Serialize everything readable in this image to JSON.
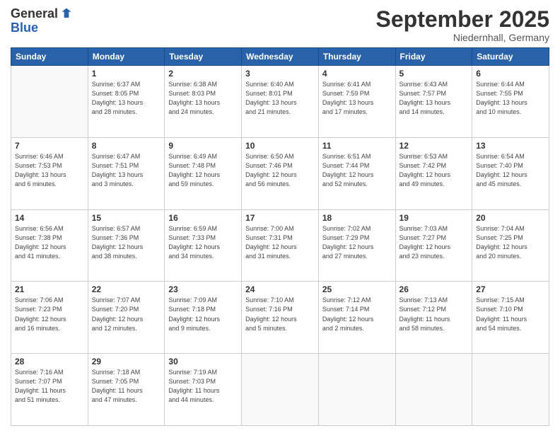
{
  "logo": {
    "general": "General",
    "blue": "Blue"
  },
  "title": "September 2025",
  "location": "Niedernhall, Germany",
  "days_header": [
    "Sunday",
    "Monday",
    "Tuesday",
    "Wednesday",
    "Thursday",
    "Friday",
    "Saturday"
  ],
  "weeks": [
    [
      {
        "day": "",
        "info": ""
      },
      {
        "day": "1",
        "info": "Sunrise: 6:37 AM\nSunset: 8:05 PM\nDaylight: 13 hours\nand 28 minutes."
      },
      {
        "day": "2",
        "info": "Sunrise: 6:38 AM\nSunset: 8:03 PM\nDaylight: 13 hours\nand 24 minutes."
      },
      {
        "day": "3",
        "info": "Sunrise: 6:40 AM\nSunset: 8:01 PM\nDaylight: 13 hours\nand 21 minutes."
      },
      {
        "day": "4",
        "info": "Sunrise: 6:41 AM\nSunset: 7:59 PM\nDaylight: 13 hours\nand 17 minutes."
      },
      {
        "day": "5",
        "info": "Sunrise: 6:43 AM\nSunset: 7:57 PM\nDaylight: 13 hours\nand 14 minutes."
      },
      {
        "day": "6",
        "info": "Sunrise: 6:44 AM\nSunset: 7:55 PM\nDaylight: 13 hours\nand 10 minutes."
      }
    ],
    [
      {
        "day": "7",
        "info": "Sunrise: 6:46 AM\nSunset: 7:53 PM\nDaylight: 13 hours\nand 6 minutes."
      },
      {
        "day": "8",
        "info": "Sunrise: 6:47 AM\nSunset: 7:51 PM\nDaylight: 13 hours\nand 3 minutes."
      },
      {
        "day": "9",
        "info": "Sunrise: 6:49 AM\nSunset: 7:48 PM\nDaylight: 12 hours\nand 59 minutes."
      },
      {
        "day": "10",
        "info": "Sunrise: 6:50 AM\nSunset: 7:46 PM\nDaylight: 12 hours\nand 56 minutes."
      },
      {
        "day": "11",
        "info": "Sunrise: 6:51 AM\nSunset: 7:44 PM\nDaylight: 12 hours\nand 52 minutes."
      },
      {
        "day": "12",
        "info": "Sunrise: 6:53 AM\nSunset: 7:42 PM\nDaylight: 12 hours\nand 49 minutes."
      },
      {
        "day": "13",
        "info": "Sunrise: 6:54 AM\nSunset: 7:40 PM\nDaylight: 12 hours\nand 45 minutes."
      }
    ],
    [
      {
        "day": "14",
        "info": "Sunrise: 6:56 AM\nSunset: 7:38 PM\nDaylight: 12 hours\nand 41 minutes."
      },
      {
        "day": "15",
        "info": "Sunrise: 6:57 AM\nSunset: 7:36 PM\nDaylight: 12 hours\nand 38 minutes."
      },
      {
        "day": "16",
        "info": "Sunrise: 6:59 AM\nSunset: 7:33 PM\nDaylight: 12 hours\nand 34 minutes."
      },
      {
        "day": "17",
        "info": "Sunrise: 7:00 AM\nSunset: 7:31 PM\nDaylight: 12 hours\nand 31 minutes."
      },
      {
        "day": "18",
        "info": "Sunrise: 7:02 AM\nSunset: 7:29 PM\nDaylight: 12 hours\nand 27 minutes."
      },
      {
        "day": "19",
        "info": "Sunrise: 7:03 AM\nSunset: 7:27 PM\nDaylight: 12 hours\nand 23 minutes."
      },
      {
        "day": "20",
        "info": "Sunrise: 7:04 AM\nSunset: 7:25 PM\nDaylight: 12 hours\nand 20 minutes."
      }
    ],
    [
      {
        "day": "21",
        "info": "Sunrise: 7:06 AM\nSunset: 7:23 PM\nDaylight: 12 hours\nand 16 minutes."
      },
      {
        "day": "22",
        "info": "Sunrise: 7:07 AM\nSunset: 7:20 PM\nDaylight: 12 hours\nand 12 minutes."
      },
      {
        "day": "23",
        "info": "Sunrise: 7:09 AM\nSunset: 7:18 PM\nDaylight: 12 hours\nand 9 minutes."
      },
      {
        "day": "24",
        "info": "Sunrise: 7:10 AM\nSunset: 7:16 PM\nDaylight: 12 hours\nand 5 minutes."
      },
      {
        "day": "25",
        "info": "Sunrise: 7:12 AM\nSunset: 7:14 PM\nDaylight: 12 hours\nand 2 minutes."
      },
      {
        "day": "26",
        "info": "Sunrise: 7:13 AM\nSunset: 7:12 PM\nDaylight: 11 hours\nand 58 minutes."
      },
      {
        "day": "27",
        "info": "Sunrise: 7:15 AM\nSunset: 7:10 PM\nDaylight: 11 hours\nand 54 minutes."
      }
    ],
    [
      {
        "day": "28",
        "info": "Sunrise: 7:16 AM\nSunset: 7:07 PM\nDaylight: 11 hours\nand 51 minutes."
      },
      {
        "day": "29",
        "info": "Sunrise: 7:18 AM\nSunset: 7:05 PM\nDaylight: 11 hours\nand 47 minutes."
      },
      {
        "day": "30",
        "info": "Sunrise: 7:19 AM\nSunset: 7:03 PM\nDaylight: 11 hours\nand 44 minutes."
      },
      {
        "day": "",
        "info": ""
      },
      {
        "day": "",
        "info": ""
      },
      {
        "day": "",
        "info": ""
      },
      {
        "day": "",
        "info": ""
      }
    ]
  ]
}
